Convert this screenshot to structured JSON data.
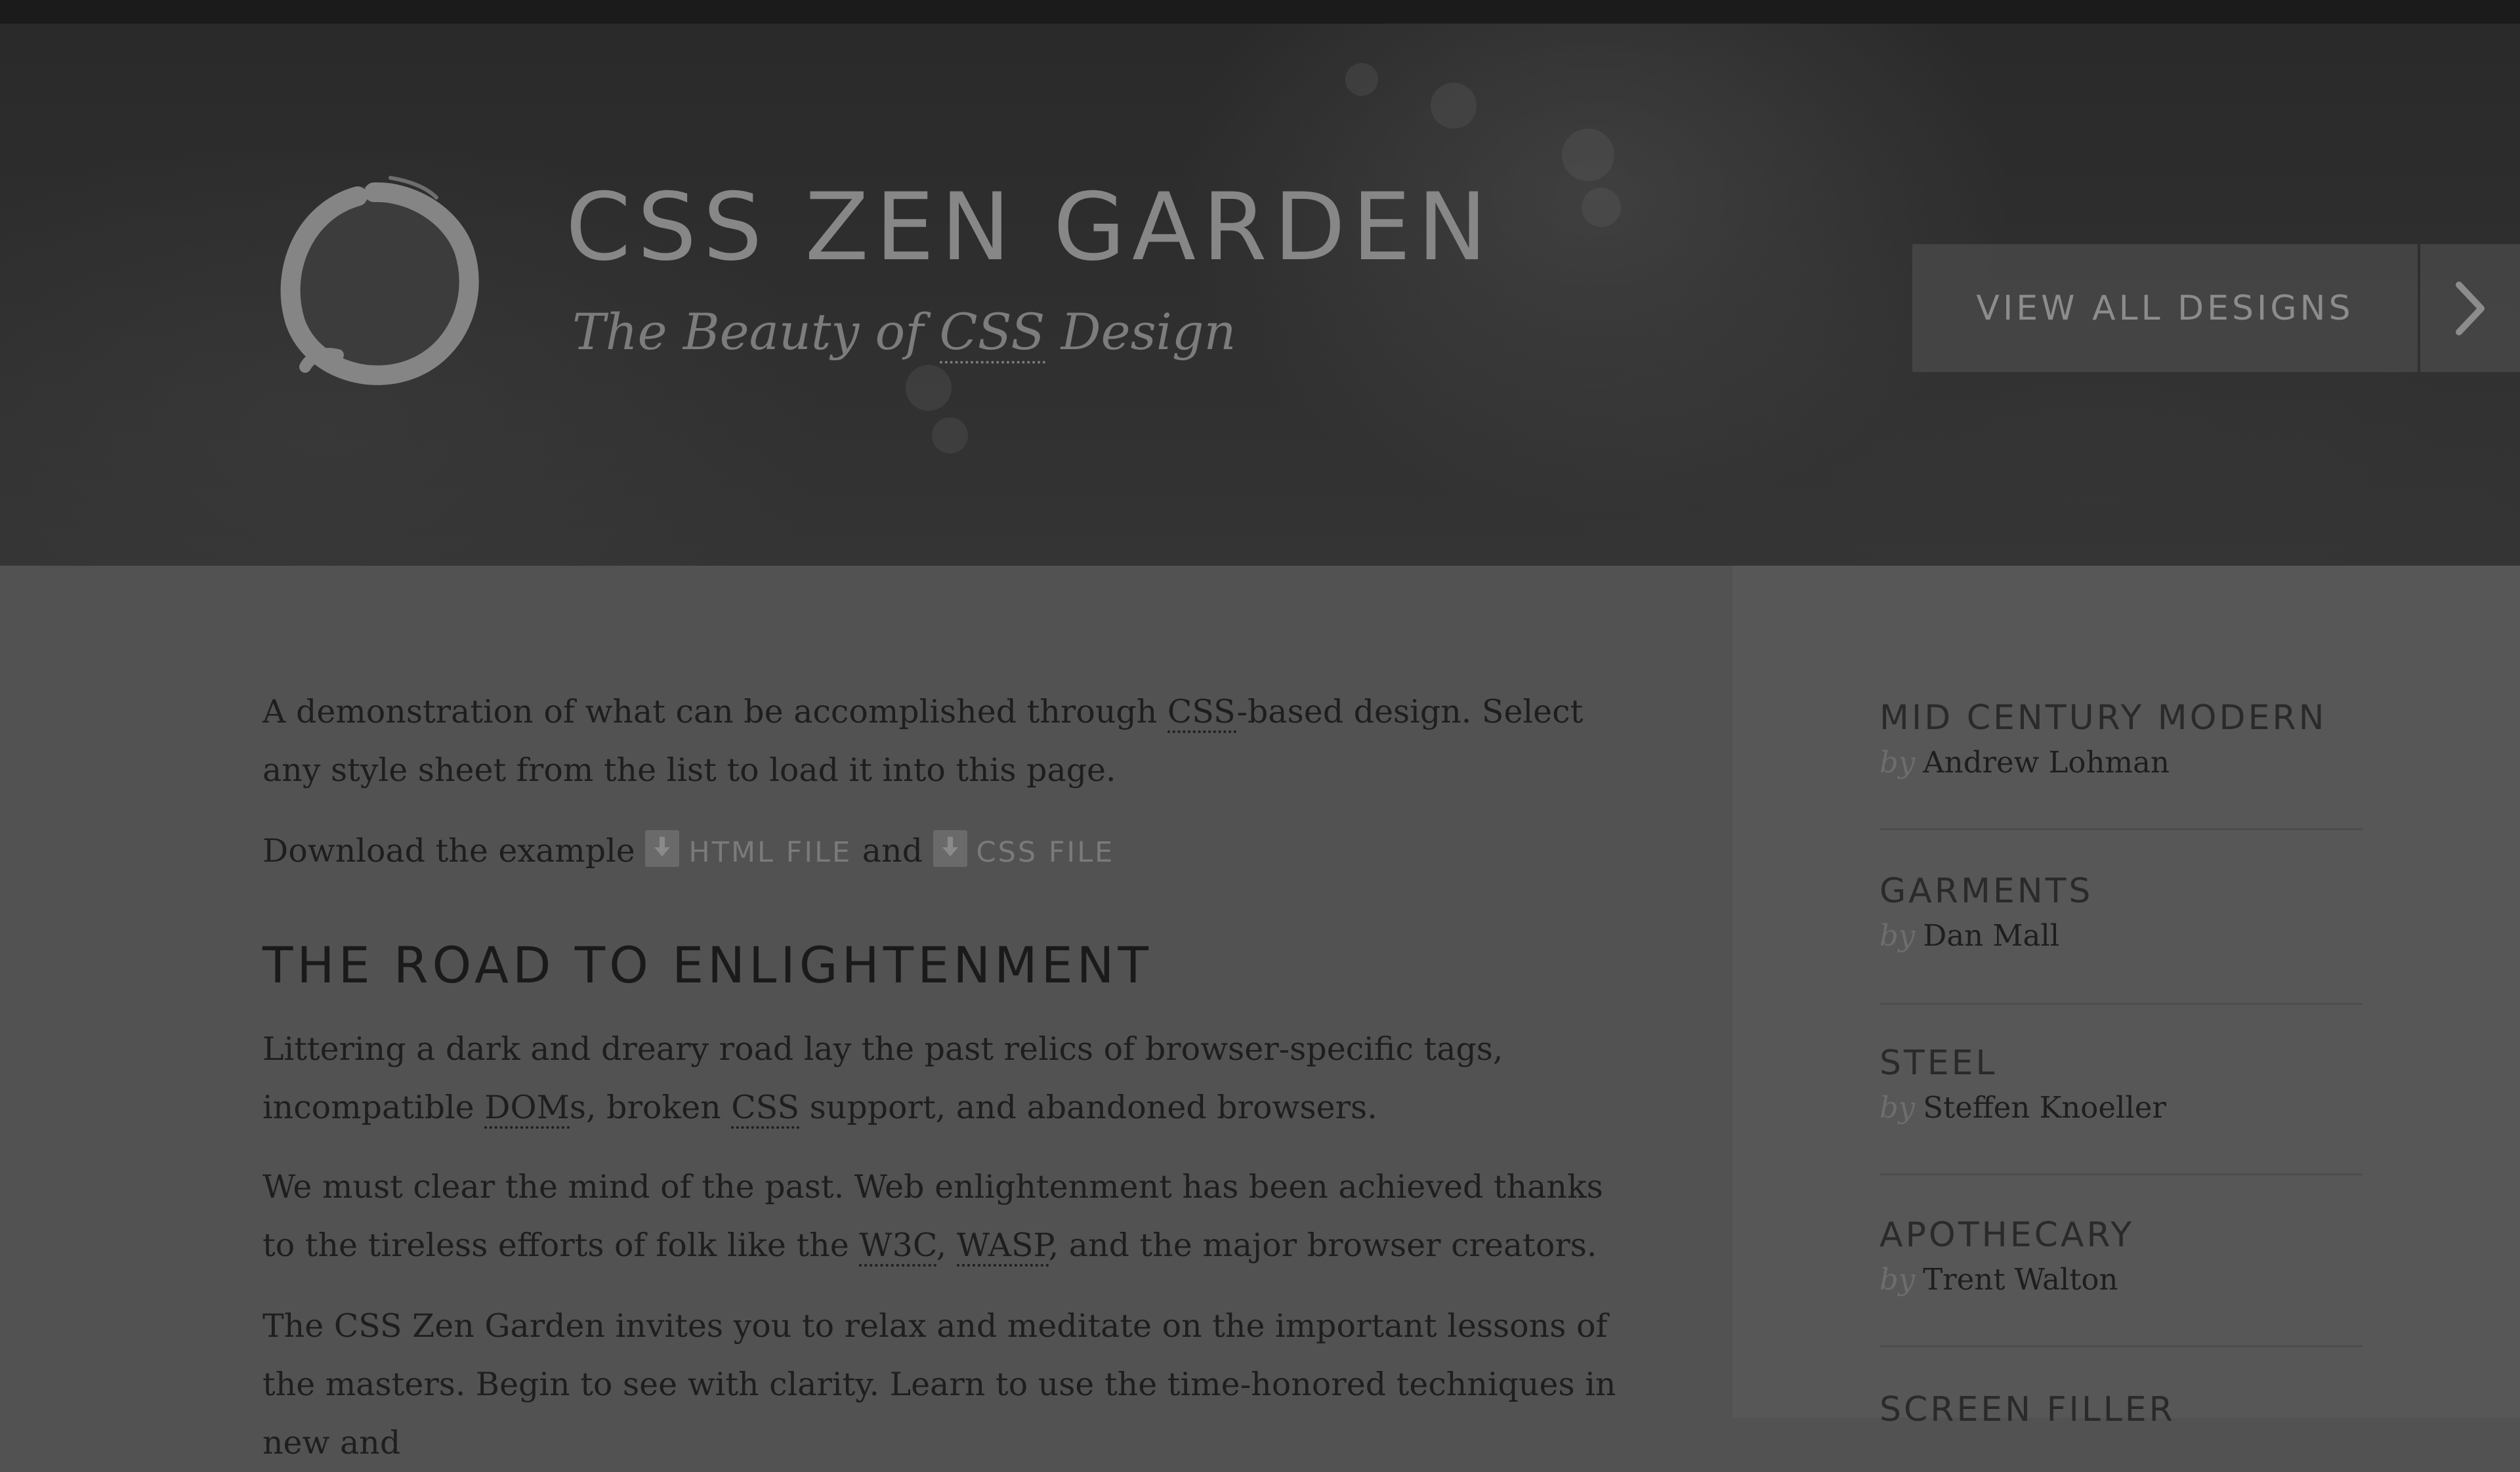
{
  "header": {
    "title": "CSS ZEN GARDEN",
    "tagline_pre": "The Beauty of ",
    "tagline_abbr": "CSS",
    "tagline_post": " Design",
    "view_all_label": "VIEW ALL DESIGNS"
  },
  "intro": {
    "pre": "A demonstration of what can be accomplished through ",
    "abbr": "CSS",
    "post": "-based design. Select any style sheet from the list to load it into this page."
  },
  "download": {
    "pre": "Download the example ",
    "html_label": "HTML FILE",
    "mid": " and ",
    "css_label": "CSS FILE"
  },
  "road": {
    "heading": "THE ROAD TO ENLIGHTENMENT",
    "p1": {
      "pre": "Littering a dark and dreary road lay the past relics of browser-specific tags, incompatible ",
      "abbr1": "DOM",
      "mid": "s, broken ",
      "abbr2": "CSS",
      "post": " support, and abandoned browsers."
    },
    "p2": {
      "pre": "We must clear the mind of the past. Web enlightenment has been achieved thanks to the tireless efforts of folk like the ",
      "abbr1": "W3C",
      "mid": ", ",
      "abbr2": "WASP",
      "post": ", and the major browser creators."
    },
    "p3": "The CSS Zen Garden invites you to relax and meditate on the important lessons of the masters. Begin to see with clarity. Learn to use the time-honored techniques in new and"
  },
  "designs": {
    "by_label": "by",
    "items": [
      {
        "name": "MID CENTURY MODERN",
        "author": "Andrew Lohman"
      },
      {
        "name": "GARMENTS",
        "author": "Dan Mall"
      },
      {
        "name": "STEEL",
        "author": "Steffen Knoeller"
      },
      {
        "name": "APOTHECARY",
        "author": "Trent Walton"
      },
      {
        "name": "SCREEN FILLER",
        "author": ""
      }
    ]
  },
  "colors": {
    "overlay_dim": "#525252",
    "header_dark": "#2a2a2a",
    "text_dark": "#1e1e1e",
    "link_muted": "#7a7a7a"
  }
}
